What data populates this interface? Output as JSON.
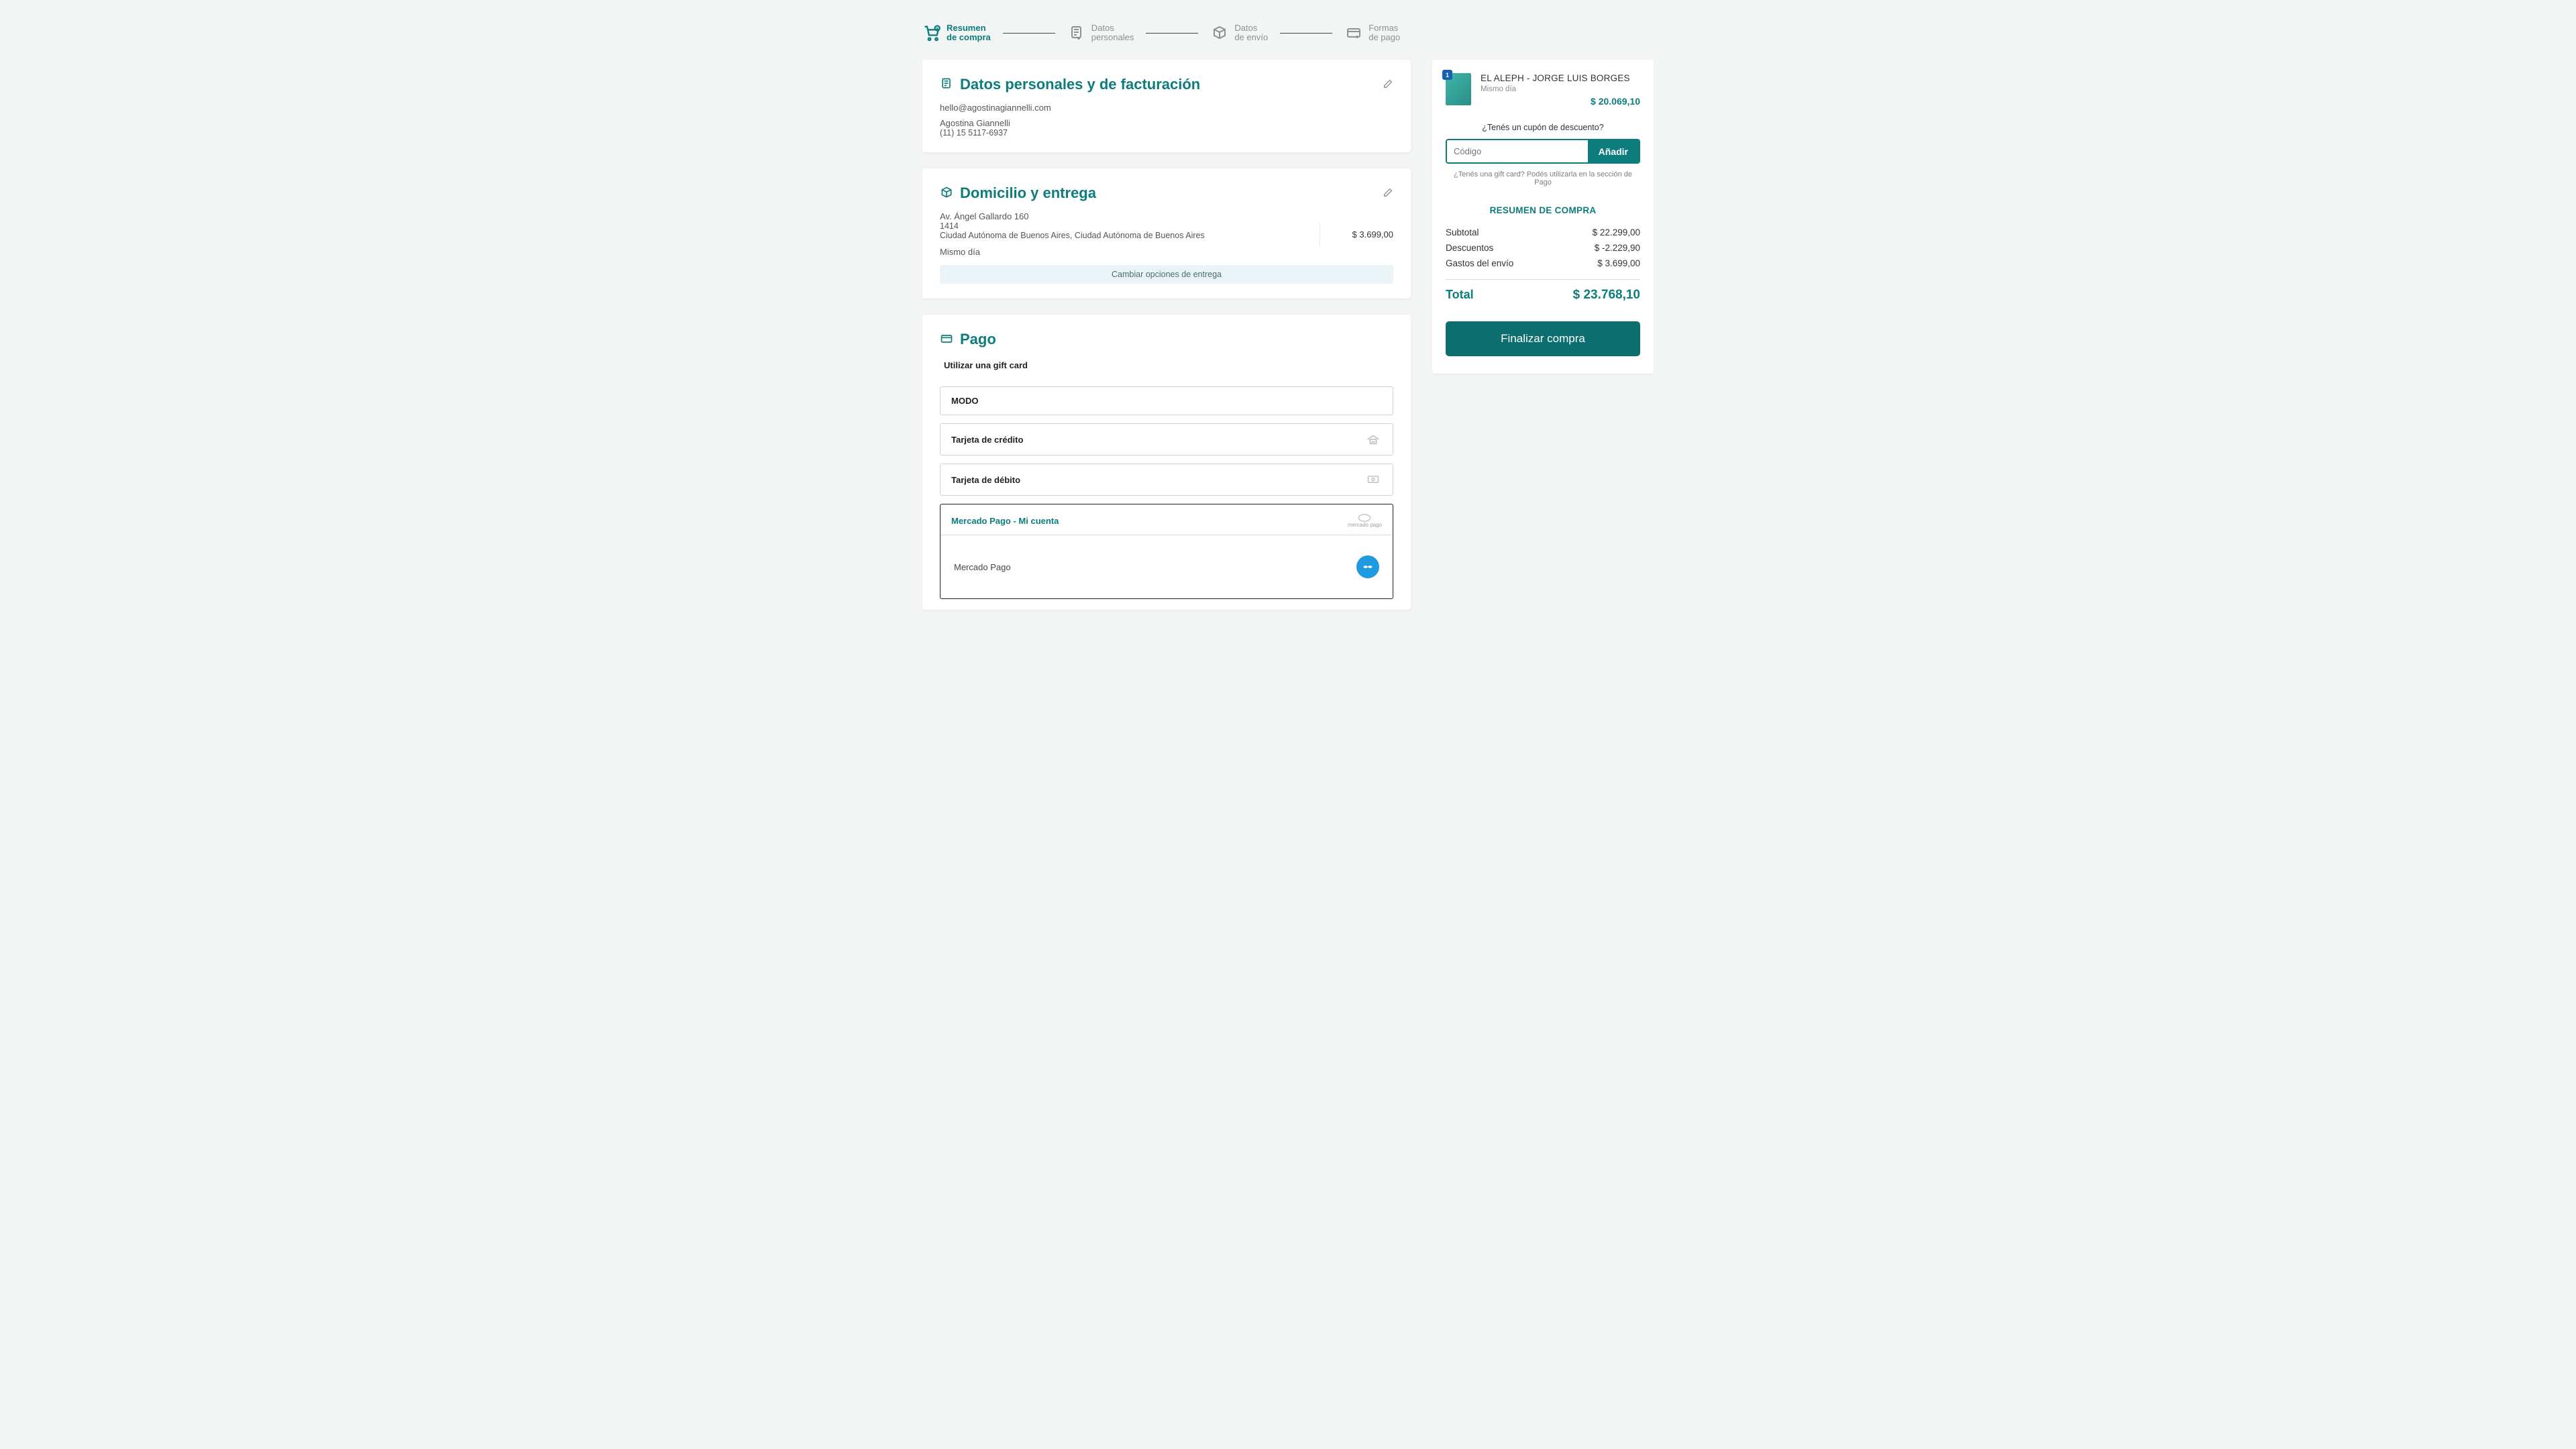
{
  "stepper": {
    "s1a": "Resumen",
    "s1b": "de compra",
    "s2a": "Datos",
    "s2b": "personales",
    "s3a": "Datos",
    "s3b": "de envío",
    "s4a": "Formas",
    "s4b": "de pago"
  },
  "personal": {
    "title": "Datos personales y de facturación",
    "email": "hello@agostinagiannelli.com",
    "name": "Agostina Giannelli",
    "phone": "(11) 15 5117-6937"
  },
  "shipping": {
    "title": "Domicilio y entrega",
    "line1": "Av. Ángel Gallardo 160",
    "zip": "1414",
    "city": "Ciudad Autónoma de Buenos Aires, Ciudad Autónoma de Buenos Aires",
    "when": "Mismo día",
    "price": "$ 3.699,00",
    "change": "Cambiar opciones de entrega"
  },
  "payment": {
    "title": "Pago",
    "gift": "Utilizar una gift card",
    "modo": "MODO",
    "credit": "Tarjeta de crédito",
    "debit": "Tarjeta de débito",
    "mp_head": "Mercado Pago - Mi cuenta",
    "mp_brand": "mercado pago",
    "mp_body": "Mercado Pago"
  },
  "side": {
    "product": {
      "qty": "1",
      "title": "EL ALEPH - JORGE LUIS BORGES",
      "sub": "Mismo día",
      "price": "$ 20.069,10"
    },
    "coupon_q": "¿Tenés un cupón de descuento?",
    "coupon_placeholder": "Código",
    "coupon_btn": "Añadir",
    "gift_hint": "¿Tenés una gift card? Podés utilizarla en la sección de Pago",
    "summary_title": "RESUMEN DE COMPRA",
    "rows": {
      "subtotal_l": "Subtotal",
      "subtotal_v": "$ 22.299,00",
      "discount_l": "Descuentos",
      "discount_v": "$ -2.229,90",
      "ship_l": "Gastos del envío",
      "ship_v": "$ 3.699,00"
    },
    "total_l": "Total",
    "total_v": "$ 23.768,10",
    "finish": "Finalizar compra"
  }
}
